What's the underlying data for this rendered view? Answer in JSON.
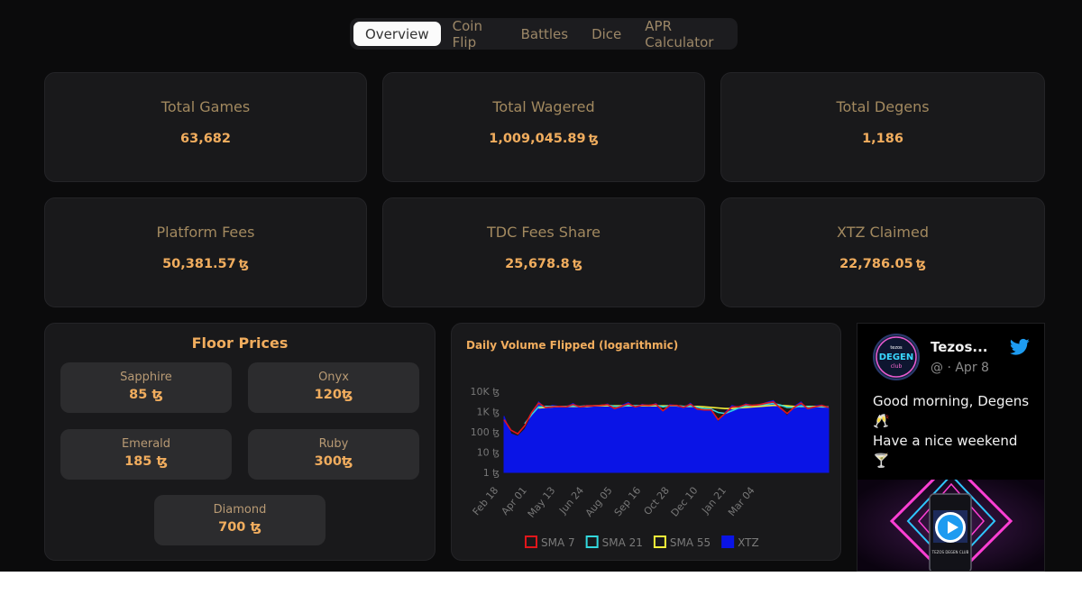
{
  "nav": {
    "tabs": [
      {
        "label": "Overview",
        "active": true
      },
      {
        "label": "Coin Flip",
        "active": false
      },
      {
        "label": "Battles",
        "active": false
      },
      {
        "label": "Dice",
        "active": false
      },
      {
        "label": "APR Calculator",
        "active": false
      }
    ]
  },
  "stats": [
    {
      "label": "Total Games",
      "value": "63,682",
      "unit": ""
    },
    {
      "label": "Total Wagered",
      "value": "1,009,045.89",
      "unit": "ꜩ"
    },
    {
      "label": "Total Degens",
      "value": "1,186",
      "unit": ""
    },
    {
      "label": "Platform Fees",
      "value": "50,381.57",
      "unit": "ꜩ"
    },
    {
      "label": "TDC Fees Share",
      "value": "25,678.8",
      "unit": "ꜩ"
    },
    {
      "label": "XTZ Claimed",
      "value": "22,786.05",
      "unit": "ꜩ"
    }
  ],
  "floor_prices": {
    "title": "Floor Prices",
    "items": [
      {
        "name": "Sapphire",
        "price": "85 ꜩ"
      },
      {
        "name": "Onyx",
        "price": "120ꜩ"
      },
      {
        "name": "Emerald",
        "price": "185 ꜩ"
      },
      {
        "name": "Ruby",
        "price": "300ꜩ"
      },
      {
        "name": "Diamond",
        "price": "700 ꜩ"
      }
    ]
  },
  "chart_data": {
    "type": "area",
    "title": "Daily Volume Flipped (logarithmic)",
    "xlabel": "",
    "ylabel": "",
    "y_scale": "log",
    "y_ticks": [
      "1 ꜩ",
      "10 ꜩ",
      "100 ꜩ",
      "1K ꜩ",
      "10K ꜩ"
    ],
    "x_ticks": [
      "Feb 18",
      "Apr 01",
      "May 13",
      "Jun 24",
      "Aug 05",
      "Sep 16",
      "Oct 28",
      "Dec 10",
      "Jan 21",
      "Mar 04"
    ],
    "legend": [
      {
        "name": "SMA 7",
        "color": "#e0161b"
      },
      {
        "name": "SMA 21",
        "color": "#32d8dd"
      },
      {
        "name": "SMA 55",
        "color": "#f4f03a"
      },
      {
        "name": "XTZ",
        "color": "#0a14e6"
      }
    ],
    "legend_position": "bottom",
    "series": [
      {
        "name": "XTZ",
        "values": [
          600,
          80,
          60,
          130,
          600,
          3000,
          1500,
          2000,
          1800,
          1700,
          2500,
          1500,
          2000,
          1800,
          1900,
          2400,
          1200,
          2000,
          2800,
          1500,
          2300,
          1900,
          2500,
          900,
          2200,
          2000,
          1500,
          2600,
          1200,
          1100,
          1500,
          300,
          900,
          2000,
          1600,
          2400,
          2000,
          2200,
          2800,
          3500,
          1400,
          600,
          1800,
          3000,
          1200,
          1900,
          2100,
          1500
        ]
      },
      {
        "name": "SMA 7",
        "values": [
          400,
          120,
          80,
          200,
          900,
          2600,
          1600,
          1700,
          1800,
          1700,
          2200,
          1700,
          1900,
          1900,
          2000,
          2200,
          1400,
          1800,
          2400,
          1700,
          2100,
          2000,
          2300,
          1100,
          2000,
          2000,
          1600,
          2300,
          1300,
          1200,
          1200,
          400,
          800,
          1700,
          1700,
          2200,
          2000,
          2200,
          2600,
          3000,
          1500,
          800,
          1600,
          2600,
          1400,
          1700,
          2000,
          1600
        ]
      },
      {
        "name": "SMA 21",
        "values": [
          null,
          null,
          null,
          250,
          700,
          1700,
          1800,
          1800,
          1800,
          1800,
          1900,
          1800,
          1900,
          1900,
          2000,
          2100,
          1800,
          1800,
          2000,
          1900,
          2000,
          2000,
          2100,
          1700,
          1900,
          1900,
          1800,
          1900,
          1600,
          1400,
          1300,
          900,
          800,
          1100,
          1500,
          1900,
          2000,
          2100,
          2300,
          2500,
          2100,
          1600,
          1600,
          1900,
          1700,
          1700,
          1800,
          1700
        ]
      },
      {
        "name": "SMA 55",
        "values": [
          null,
          null,
          null,
          null,
          null,
          1500,
          1600,
          1700,
          1800,
          1800,
          1800,
          1800,
          1800,
          1900,
          1900,
          1900,
          1900,
          1900,
          1900,
          1900,
          1900,
          1900,
          1900,
          1900,
          1900,
          1900,
          1800,
          1800,
          1800,
          1700,
          1600,
          1500,
          1400,
          1400,
          1500,
          1600,
          1700,
          1800,
          1900,
          2000,
          2000,
          1900,
          1800,
          1800,
          1800,
          1800,
          1700,
          1700
        ]
      }
    ]
  },
  "tweet": {
    "author": "Tezos...",
    "handle": "@ · Apr 8",
    "text_line1": "Good morning, Degens",
    "text_line2": "🥂",
    "text_line3": "Have a nice weekend",
    "text_line4": "🍸",
    "avatar_logo": "tezos DEGEN club",
    "media_caption": "TEZOS DEGEN CLUB"
  }
}
